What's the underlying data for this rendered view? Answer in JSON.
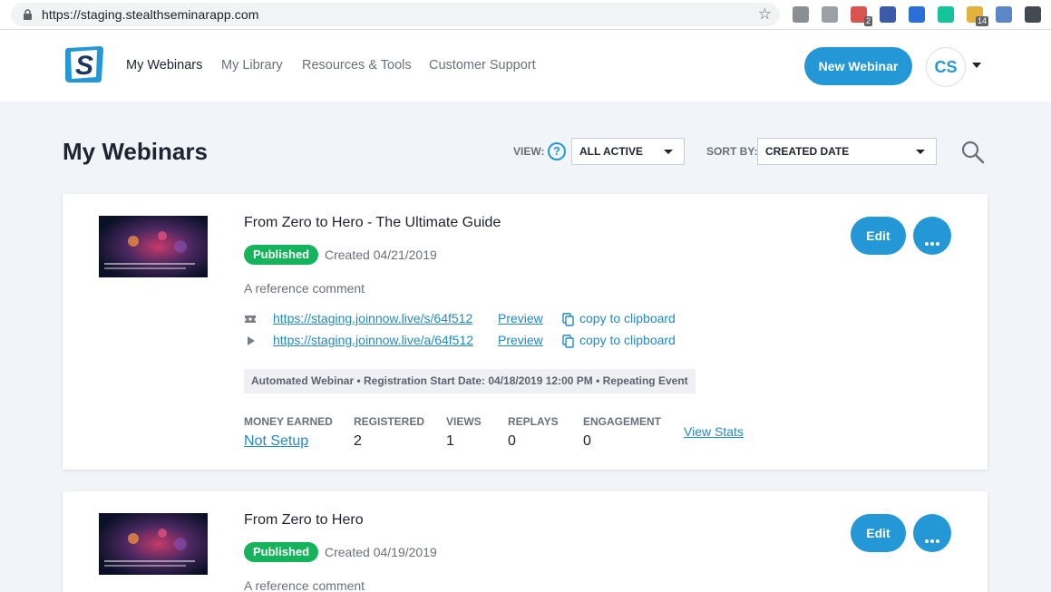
{
  "browser": {
    "url": "https://staging.stealthseminarapp.com",
    "extensions": [
      {
        "name": "devtools-extension-icon",
        "color": "#8a8f96",
        "badge": ""
      },
      {
        "name": "ghost-extension-icon",
        "color": "#9aa0a6",
        "badge": ""
      },
      {
        "name": "mail-extension-icon",
        "color": "#d9534f",
        "badge": "2"
      },
      {
        "name": "notepad-extension-icon",
        "color": "#3a5ca8",
        "badge": ""
      },
      {
        "name": "circle-extension-icon",
        "color": "#2a6fd8",
        "badge": ""
      },
      {
        "name": "grammarly-extension-icon",
        "color": "#15c39a",
        "badge": ""
      },
      {
        "name": "folder-extension-icon",
        "color": "#e4b23a",
        "badge": "14"
      },
      {
        "name": "info-extension-icon",
        "color": "#5a87c6",
        "badge": ""
      },
      {
        "name": "dropper-extension-icon",
        "color": "#444a52",
        "badge": ""
      }
    ]
  },
  "header": {
    "nav": [
      "My Webinars",
      "My Library",
      "Resources & Tools",
      "Customer Support"
    ],
    "new_webinar": "New Webinar",
    "avatar_initials": "CS"
  },
  "page": {
    "title": "My Webinars",
    "view_label": "VIEW:",
    "view_value": "ALL ACTIVE",
    "sort_label": "SORT BY:",
    "sort_value": "CREATED DATE"
  },
  "webinars": [
    {
      "title": "From Zero to Hero - The Ultimate Guide",
      "status": "Published",
      "created": "Created 04/21/2019",
      "comment": "A reference comment",
      "registration_url": "https://staging.joinnow.live/s/64f512",
      "attendee_url": "https://staging.joinnow.live/a/64f512",
      "preview_label": "Preview",
      "copy_label": "copy to clipboard",
      "info": "Automated Webinar • Registration Start Date: 04/18/2019 12:00 PM • Repeating Event",
      "stats": {
        "money_label": "MONEY EARNED",
        "money_value": "Not Setup",
        "registered_label": "REGISTERED",
        "registered_value": "2",
        "views_label": "VIEWS",
        "views_value": "1",
        "replays_label": "REPLAYS",
        "replays_value": "0",
        "engagement_label": "ENGAGEMENT",
        "engagement_value": "0",
        "view_stats": "View Stats"
      },
      "edit_label": "Edit"
    },
    {
      "title": "From Zero to Hero",
      "status": "Published",
      "created": "Created 04/19/2019",
      "comment": "A reference comment",
      "edit_label": "Edit"
    }
  ],
  "colors": {
    "primary": "#2498d6",
    "published": "#15b35c",
    "link": "#2489c4"
  }
}
